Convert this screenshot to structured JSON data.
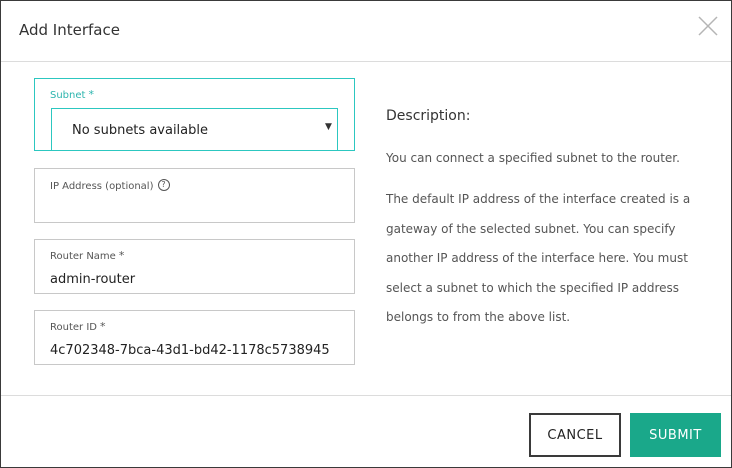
{
  "dialog": {
    "title": "Add Interface"
  },
  "form": {
    "subnet": {
      "label": "Subnet",
      "required_mark": "*",
      "selected": "No subnets available"
    },
    "ip_address": {
      "label": "IP Address (optional)",
      "help_glyph": "?",
      "value": ""
    },
    "router_name": {
      "label": "Router Name",
      "required_mark": "*",
      "value": "admin-router"
    },
    "router_id": {
      "label": "Router ID",
      "required_mark": "*",
      "value": "4c702348-7bca-43d1-bd42-1178c5738945"
    }
  },
  "description": {
    "title": "Description:",
    "paragraph1": "You can connect a specified subnet to the router.",
    "paragraph2": "The default IP address of the interface created is a gateway of the selected subnet. You can specify another IP address of the interface here. You must select a subnet to which the specified IP address belongs to from the above list."
  },
  "footer": {
    "cancel_label": "CANCEL",
    "submit_label": "SUBMIT"
  },
  "colors": {
    "accent": "#2cc7c0",
    "submit": "#1aa88a"
  }
}
